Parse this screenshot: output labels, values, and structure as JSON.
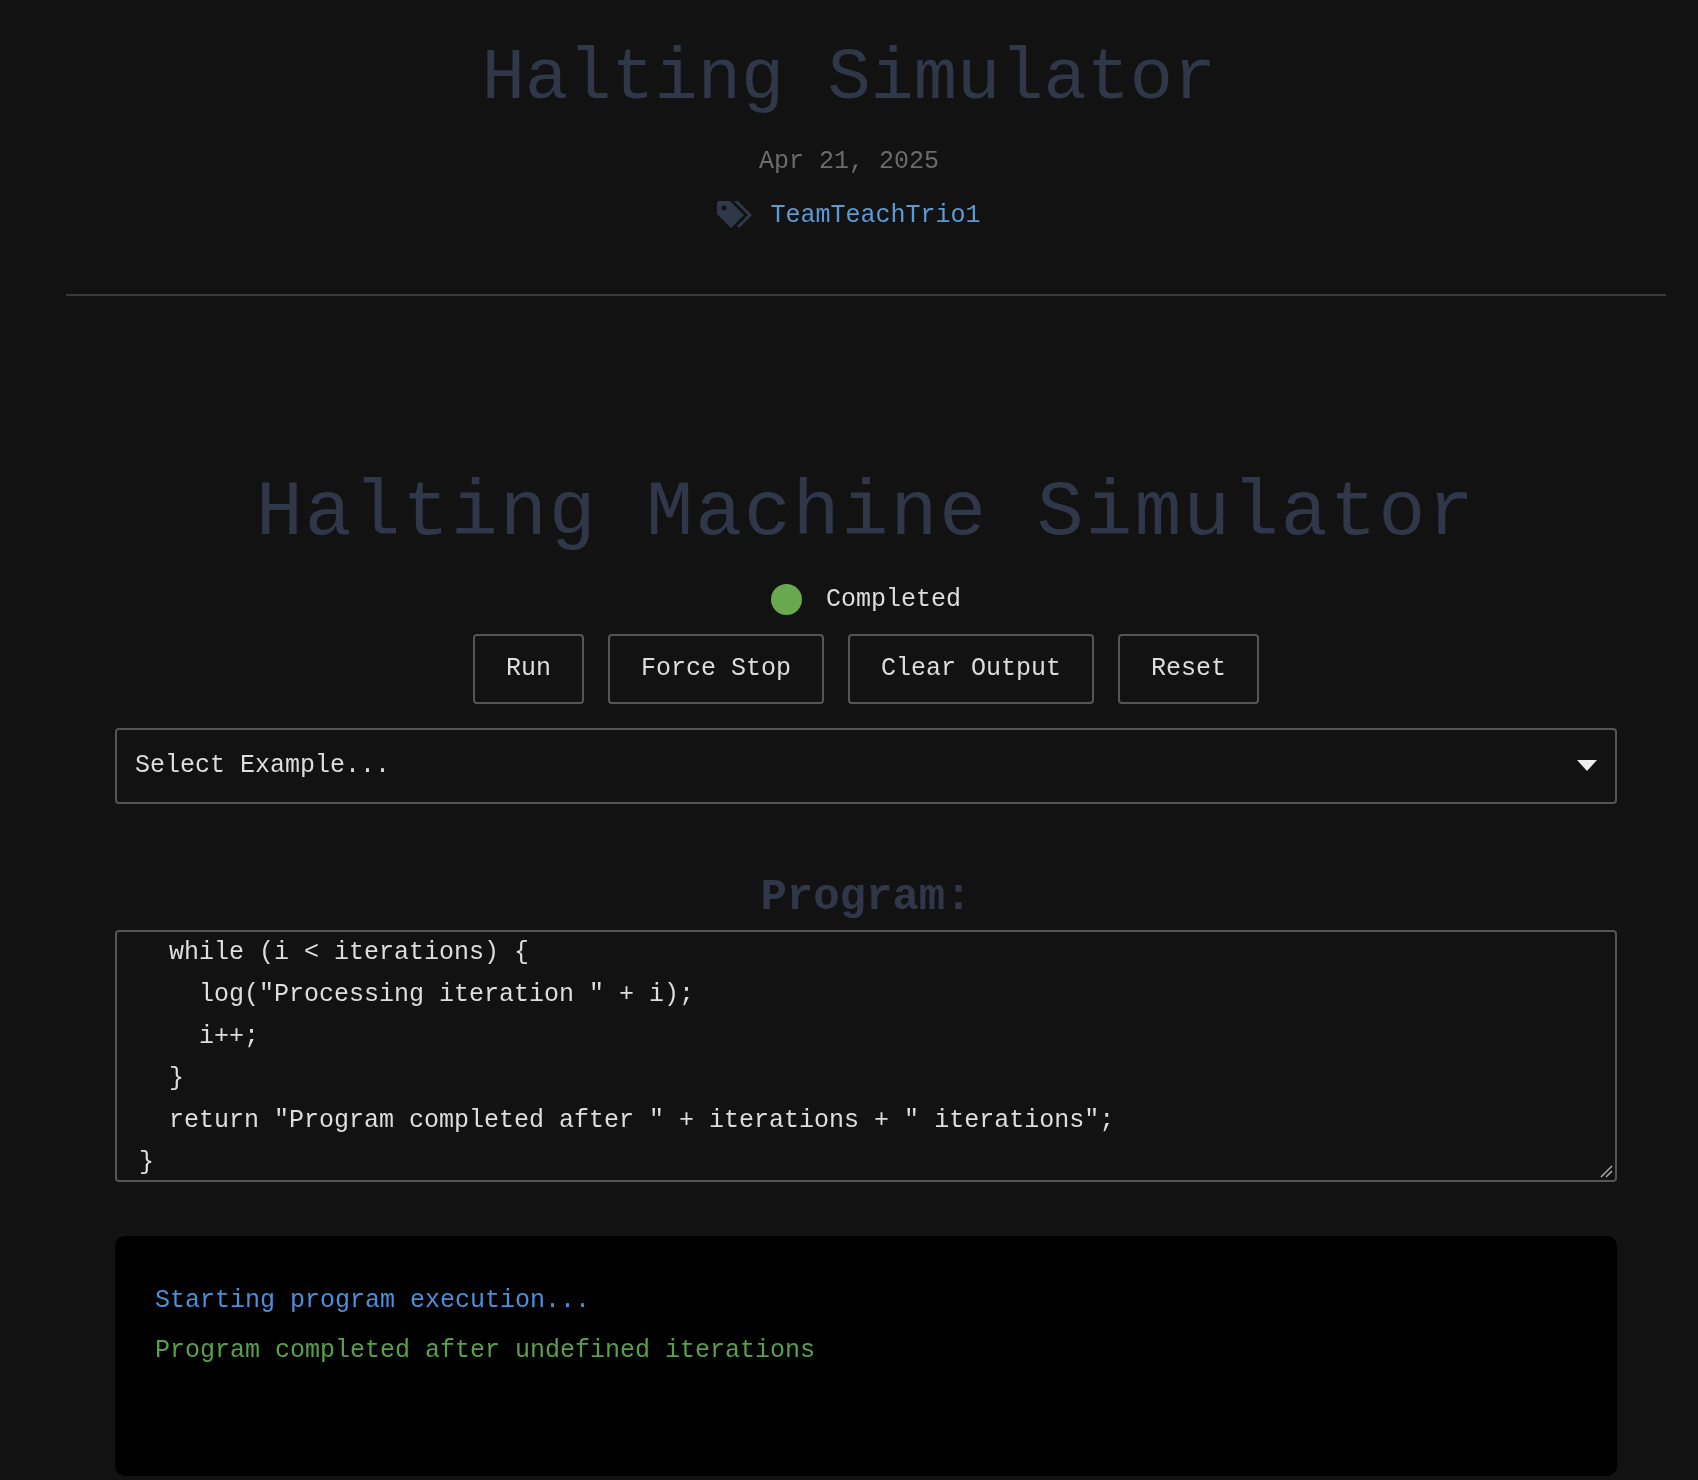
{
  "post": {
    "title": "Halting Simulator",
    "date": "Apr 21, 2025",
    "tags": [
      "TeamTeachTrio1"
    ]
  },
  "simulator": {
    "title": "Halting Machine Simulator",
    "status": {
      "label": "Completed",
      "color": "#6aa84f"
    },
    "buttons": [
      "Run",
      "Force Stop",
      "Clear Output",
      "Reset"
    ],
    "example_select": {
      "value": "Select Example..."
    },
    "program_label": "Program:",
    "code_lines": [
      "  while (i < iterations) {",
      "    log(\"Processing iteration \" + i);",
      "    i++;",
      "  }",
      "  return \"Program completed after \" + iterations + \" iterations\";",
      "}"
    ],
    "output": [
      {
        "kind": "info",
        "text": "Starting program execution..."
      },
      {
        "kind": "success",
        "text": "Program completed after undefined iterations"
      }
    ]
  }
}
